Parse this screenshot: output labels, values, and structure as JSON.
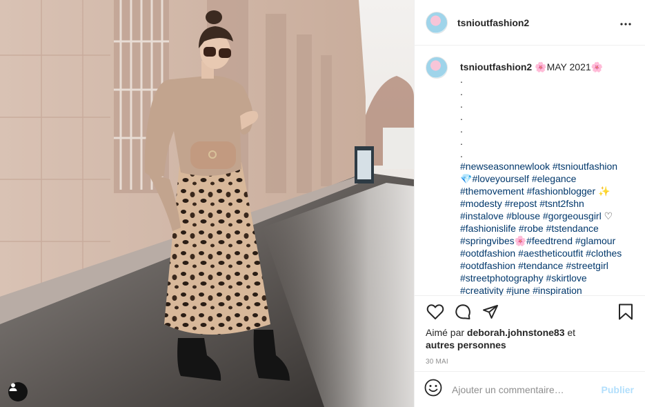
{
  "post": {
    "username": "tsnioutfashion2",
    "more_icon": "more-horizontal-icon",
    "user_tag_icon": "user-tag-icon"
  },
  "caption": {
    "username": "tsnioutfashion2",
    "flower_left": "🌸",
    "title": "MAY 2021",
    "flower_right": "🌸",
    "dots": [
      ".",
      ".",
      ".",
      ".",
      ".",
      ".",
      "."
    ],
    "hashtags": {
      "l1a": "#newseasonnewlook",
      "l1b": "#tsnioutfashion",
      "l2e": "💎",
      "l2a": "#loveyourself",
      "l2b": "#elegance",
      "l3a": "#themovement",
      "l3b": "#fashionblogger",
      "l3e": "✨",
      "l4a": "#modesty",
      "l4b": "#repost",
      "l4c": "#tsnt2fshn",
      "l5a": "#instalove",
      "l5b": "#blouse",
      "l5c": "#gorgeousgirl",
      "l5e": "♡",
      "l6a": "#fashionislife",
      "l6b": "#robe",
      "l6c": "#tstendance",
      "l7a": "#springvibes",
      "l7e": "🌸",
      "l7b": "#feedtrend",
      "l7c": "#glamour",
      "l8a": "#ootdfashion",
      "l8b": "#aestheticoutfit",
      "l8c": "#clothes",
      "l9a": "#ootdfashion",
      "l9b": "#tendance",
      "l9c": "#streetgirl",
      "l10a": "#streetphotography",
      "l10b": "#skirtlove",
      "l11a": "#creativity",
      "l11b": "#june",
      "l11c": "#inspiration"
    }
  },
  "actions": {
    "icons": [
      "heart-icon",
      "comment-icon",
      "share-icon",
      "bookmark-icon"
    ],
    "likes_prefix": "Aimé par",
    "likes_user": "deborah.johnstone83",
    "likes_suffix": "et",
    "likes_others": "autres personnes",
    "date": "30 MAI"
  },
  "comment": {
    "placeholder": "Ajouter un commentaire…",
    "publish_label": "Publier",
    "emoji_icon": "smiley-icon"
  },
  "colors": {
    "link": "#00376b",
    "publish_disabled": "#b2dffc",
    "muted": "#8e8e8e",
    "border": "#efefef"
  }
}
